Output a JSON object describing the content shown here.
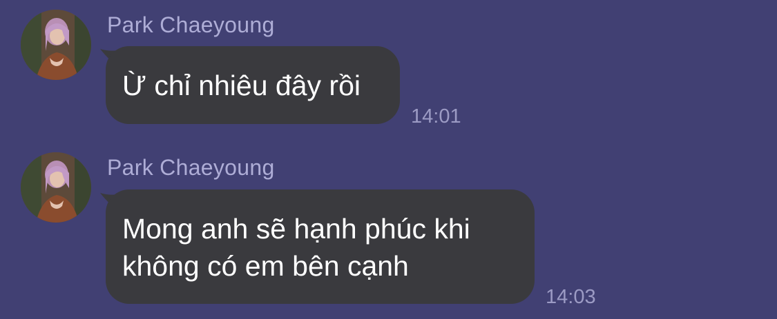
{
  "messages": [
    {
      "sender": "Park Chaeyoung",
      "lines": [
        "Ừ chỉ nhiêu đây rồi"
      ],
      "time": "14:01",
      "avatar_icon": "profile-photo"
    },
    {
      "sender": "Park Chaeyoung",
      "lines": [
        "Mong anh sẽ hạnh phúc khi",
        "không có em bên cạnh"
      ],
      "time": "14:03",
      "avatar_icon": "profile-photo"
    }
  ],
  "colors": {
    "background": "#414073",
    "bubble": "#3a3a3e",
    "sender_name": "#aeadd6",
    "timestamp": "#9c9bc4",
    "message_text": "#ffffff"
  }
}
